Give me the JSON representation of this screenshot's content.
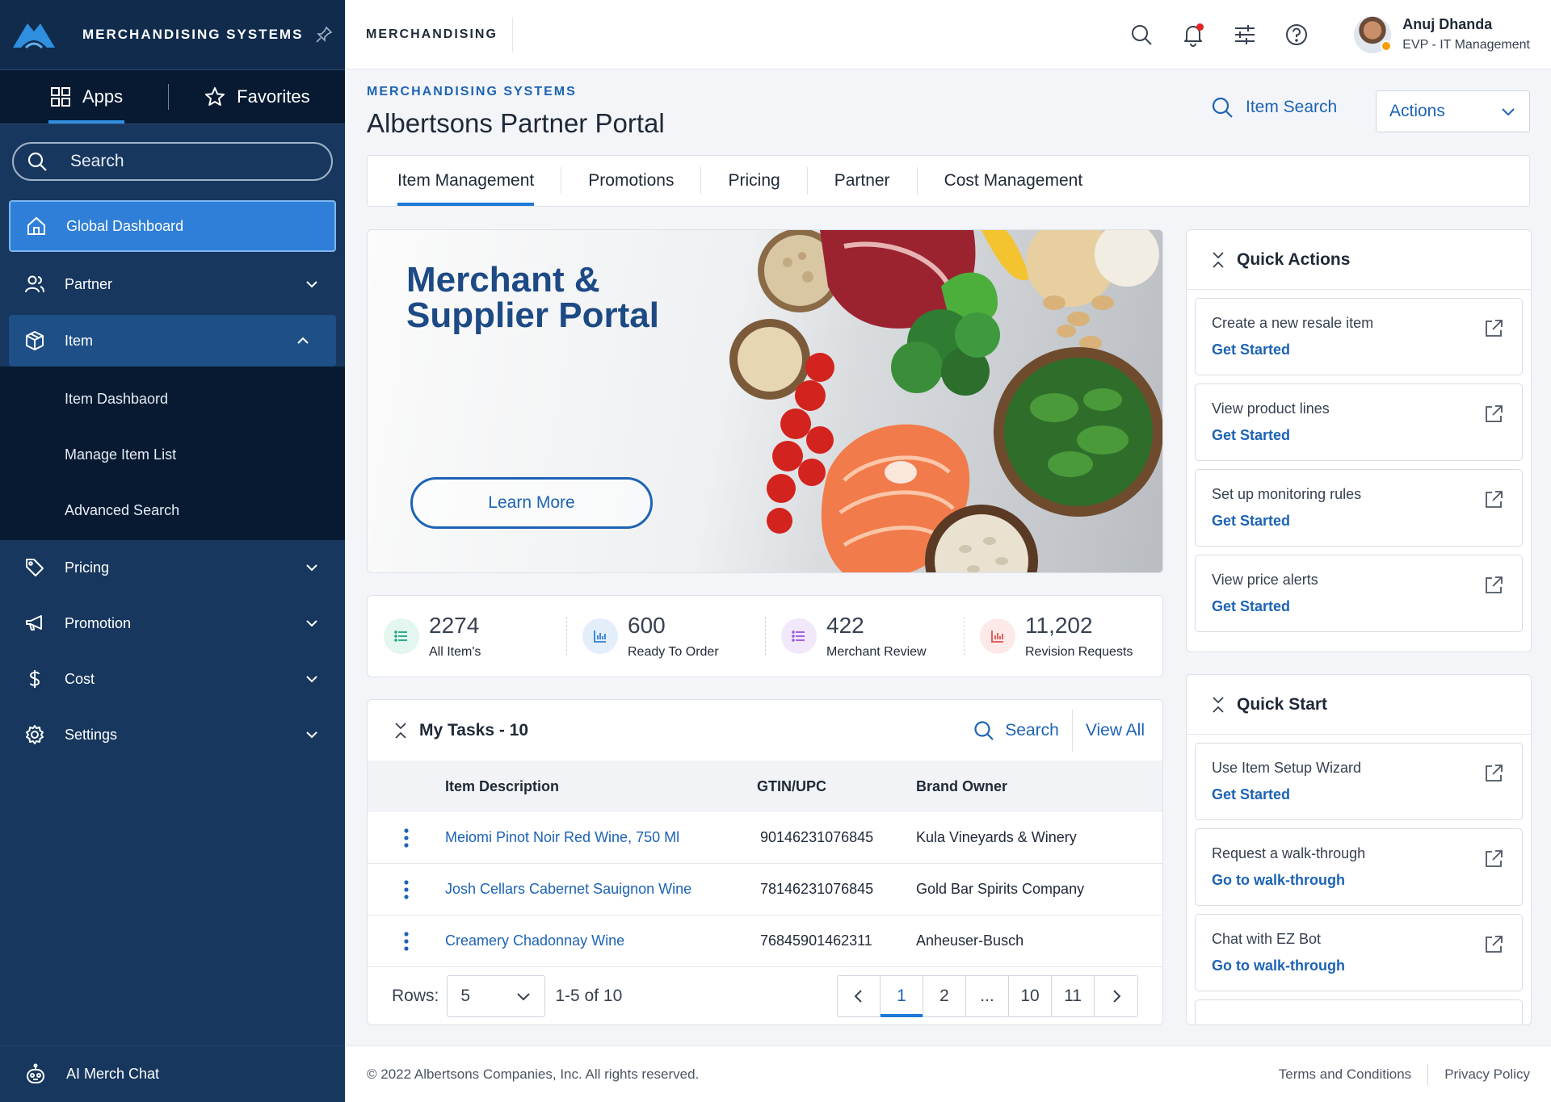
{
  "sidebar": {
    "brand": "MERCHANDISING SYSTEMS",
    "tabs": {
      "apps": "Apps",
      "favorites": "Favorites"
    },
    "search_placeholder": "Search",
    "nav": {
      "global_dashboard": "Global Dashboard",
      "partner": "Partner",
      "item": "Item",
      "item_sub": [
        "Item Dashbaord",
        "Manage Item List",
        "Advanced Search"
      ],
      "pricing": "Pricing",
      "promotion": "Promotion",
      "cost": "Cost",
      "settings": "Settings"
    },
    "ai_chat": "AI Merch Chat"
  },
  "topbar": {
    "title": "MERCHANDISING",
    "user": {
      "name": "Anuj Dhanda",
      "role": "EVP - IT Management"
    },
    "icons": [
      "search-icon",
      "bell-icon",
      "sliders-icon",
      "help-icon"
    ]
  },
  "header": {
    "kicker": "MERCHANDISING SYSTEMS",
    "title": "Albertsons Partner Portal",
    "item_search": "Item Search",
    "actions": "Actions"
  },
  "tabs": [
    "Item Management",
    "Promotions",
    "Pricing",
    "Partner",
    "Cost Management"
  ],
  "hero": {
    "title_line1": "Merchant &",
    "title_line2": "Supplier Portal",
    "button": "Learn More"
  },
  "stats": [
    {
      "value": "2274",
      "label": "All Item's",
      "color": "#16a37f",
      "bg": "#e3f6ef"
    },
    {
      "value": "600",
      "label": "Ready To Order",
      "color": "#2f7fd8",
      "bg": "#e4eefb"
    },
    {
      "value": "422",
      "label": "Merchant Review",
      "color": "#9b51e0",
      "bg": "#f1e8fb"
    },
    {
      "value": "11,202",
      "label": "Revision Requests",
      "color": "#e0524d",
      "bg": "#fde9e8"
    }
  ],
  "tasks": {
    "title": "My Tasks - 10",
    "search": "Search",
    "view_all": "View All",
    "columns": [
      "Item Description",
      "GTIN/UPC",
      "Brand Owner"
    ],
    "rows": [
      {
        "desc": "Meiomi Pinot Noir Red Wine, 750 Ml",
        "gtin": "90146231076845",
        "brand": "Kula Vineyards & Winery"
      },
      {
        "desc": "Josh Cellars Cabernet Sauignon Wine",
        "gtin": "78146231076845",
        "brand": "Gold Bar Spirits Company"
      },
      {
        "desc": "Creamery Chadonnay Wine",
        "gtin": "76845901462311",
        "brand": "Anheuser-Busch"
      }
    ],
    "pager": {
      "rows_label": "Rows:",
      "rows_value": "5",
      "range": "1-5 of 10",
      "pages": [
        "1",
        "2",
        "...",
        "10",
        "11"
      ]
    }
  },
  "quick_actions": {
    "title": "Quick Actions",
    "items": [
      {
        "title": "Create a new resale item",
        "link": "Get Started"
      },
      {
        "title": "View product lines",
        "link": "Get Started"
      },
      {
        "title": "Set up monitoring rules",
        "link": "Get Started"
      },
      {
        "title": "View price alerts",
        "link": "Get Started"
      }
    ]
  },
  "quick_start": {
    "title": "Quick Start",
    "items": [
      {
        "title": "Use Item Setup Wizard",
        "link": "Get Started"
      },
      {
        "title": "Request a walk-through",
        "link": "Go to walk-through"
      },
      {
        "title": "Chat with EZ Bot",
        "link": "Go to walk-through"
      }
    ]
  },
  "footer": {
    "copyright": "© 2022 Albertsons Companies, Inc. All rights reserved.",
    "terms": "Terms and Conditions",
    "privacy": "Privacy Policy"
  },
  "colors": {
    "sidebar": "#17375e",
    "accent": "#1d63b5",
    "active_nav": "#2f7fd8"
  }
}
